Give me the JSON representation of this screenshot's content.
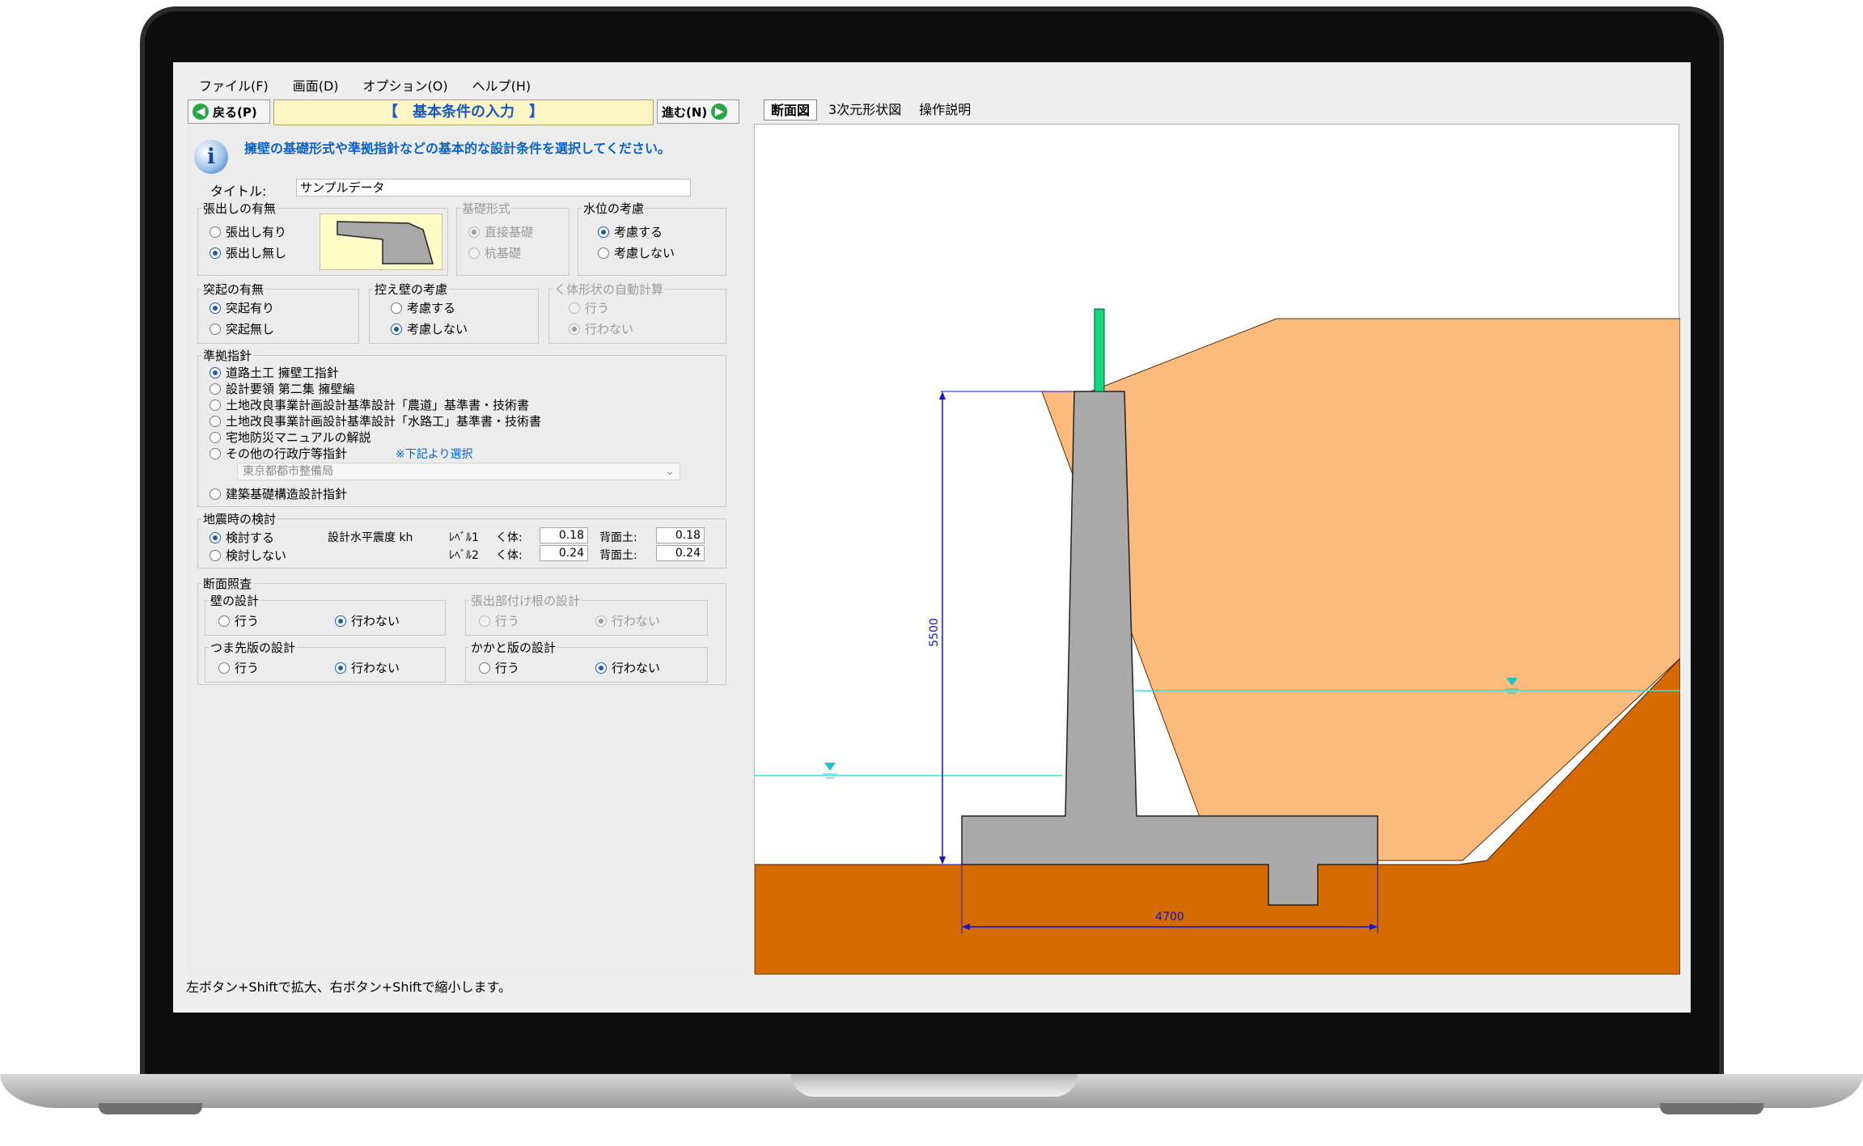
{
  "menu": [
    "ファイル(F)",
    "画面(D)",
    "オプション(O)",
    "ヘルプ(H)"
  ],
  "nav": {
    "back_label": "戻る(P)",
    "next_label": "進む(N)",
    "step_title": "【　基本条件の入力　】"
  },
  "info": {
    "message": "擁壁の基礎形式や準拠指針などの基本的な設計条件を選択してください。"
  },
  "title_field": {
    "label": "タイトル:",
    "value": "サンプルデータ"
  },
  "overhang": {
    "label": "張出しの有無",
    "options": [
      "張出し有り",
      "張出し無し"
    ],
    "selected": 1
  },
  "foundation": {
    "label": "基礎形式",
    "options": [
      "直接基礎",
      "杭基礎"
    ],
    "selected": 0,
    "disabled": true
  },
  "water_level": {
    "label": "水位の考慮",
    "options": [
      "考慮する",
      "考慮しない"
    ],
    "selected": 0
  },
  "key": {
    "label": "突起の有無",
    "options": [
      "突起有り",
      "突起無し"
    ],
    "selected": 0
  },
  "counterfort": {
    "label": "控え壁の考慮",
    "options": [
      "考慮する",
      "考慮しない"
    ],
    "selected": 1
  },
  "auto_calc": {
    "label": "く体形状の自動計算",
    "options": [
      "行う",
      "行わない"
    ],
    "selected": 1,
    "disabled": true
  },
  "guideline": {
    "label": "準拠指針",
    "options": [
      "道路土工 擁壁工指針",
      "設計要領 第二集 擁壁編",
      "土地改良事業計画設計基準設計「農道」基準書・技術書",
      "土地改良事業計画設計基準設計「水路工」基準書・技術書",
      "宅地防災マニュアルの解説",
      "その他の行政庁等指針",
      "建築基礎構造設計指針"
    ],
    "selected": 0,
    "note": "※下記より選択",
    "combo_value": "東京都都市整備局"
  },
  "seismic": {
    "label": "地震時の検討",
    "options": [
      "検討する",
      "検討しない"
    ],
    "selected": 0,
    "coef_label": "設計水平震度 kh",
    "level1": "ﾚﾍﾞﾙ1",
    "level2": "ﾚﾍﾞﾙ2",
    "body_label": "く体:",
    "back_label": "背面土:",
    "l1_body": "0.18",
    "l1_back": "0.18",
    "l2_body": "0.24",
    "l2_back": "0.24"
  },
  "section_check": {
    "label": "断面照査",
    "wall": {
      "label": "壁の設計",
      "options": [
        "行う",
        "行わない"
      ],
      "selected": 1
    },
    "overhang_root": {
      "label": "張出部付け根の設計",
      "options": [
        "行う",
        "行わない"
      ],
      "selected": 1,
      "disabled": true
    },
    "toe": {
      "label": "つま先版の設計",
      "options": [
        "行う",
        "行わない"
      ],
      "selected": 1
    },
    "heel": {
      "label": "かかと版の設計",
      "options": [
        "行う",
        "行わない"
      ],
      "selected": 1
    }
  },
  "tabs": [
    "断面図",
    "3次元形状図",
    "操作説明"
  ],
  "drawing": {
    "height_dim": "5500",
    "width_dim": "4700",
    "colors": {
      "backfill": "#fcbb7d",
      "ground": "#d46a00",
      "concrete": "#a9a9a9",
      "railing": "#11d67a",
      "water": "#32e0e0",
      "dimension": "#1414d0"
    }
  },
  "status": "左ボタン+Shiftで拡大、右ボタン+Shiftで縮小します。"
}
